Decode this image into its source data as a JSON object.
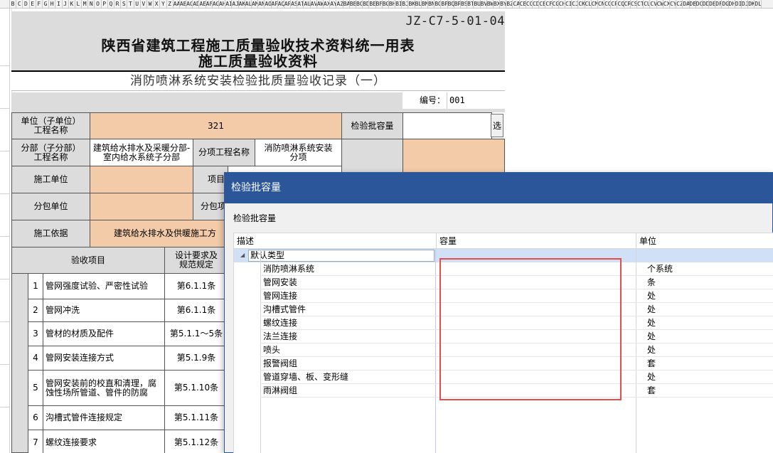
{
  "column_header_letters": [
    "B",
    "C",
    "D",
    "E",
    "F",
    "G",
    "H",
    "I",
    "J",
    "K",
    "L",
    "M",
    "N",
    "O",
    "P",
    "Q",
    "R",
    "S",
    "T",
    "U",
    "V",
    "W",
    "X",
    "Y",
    "Z",
    "AA",
    "AB",
    "AC",
    "AD",
    "AE",
    "AF",
    "AG",
    "AH",
    "AI",
    "AJ",
    "AK",
    "AL",
    "AM",
    "AN",
    "AO",
    "AP",
    "AQ",
    "AR",
    "AS",
    "AT",
    "AU",
    "AV",
    "AW",
    "AX",
    "AY",
    "AZ",
    "BA",
    "BB",
    "BC",
    "BD",
    "BE",
    "BF",
    "BG",
    "BH",
    "BI",
    "BJ",
    "BK",
    "BL",
    "BM",
    "BN",
    "BO",
    "BP",
    "BQ",
    "BR",
    "BS",
    "BT",
    "BU",
    "BV",
    "BW",
    "BX",
    "BY",
    "BZ",
    "CA",
    "CB",
    "CC",
    "CD",
    "CE",
    "CF",
    "CG",
    "CH",
    "CI",
    "CJ",
    "CK",
    "CL",
    "CM",
    "CN",
    "CO",
    "CP",
    "CQ",
    "CR",
    "CS",
    "CT",
    "CU",
    "CV",
    "CW",
    "CX",
    "CY",
    "CZ",
    "DA",
    "DB",
    "DC",
    "DD",
    "DE",
    "DF",
    "DG",
    "DH",
    "DI",
    "DJ",
    "DK",
    "DL"
  ],
  "form": {
    "code": "JZ-C7-5-01-04",
    "title_line1": "陕西省建筑工程施工质量验收技术资料统一用表",
    "title_line2": "施工质量验收资料",
    "subtitle": "消防喷淋系统安装检验批质量验收记录（一）",
    "number_label": "编号：",
    "number_value": "001",
    "unit_project_label": "单位（子单位）\n工程名称",
    "unit_project_value": "321",
    "batch_capacity_label": "检验批容量",
    "batch_capacity_value": "",
    "select_button": "选",
    "sub_division_label": "分部（子分部）\n工程名称",
    "sub_division_value": "建筑给水排水及采暖分部-室内给水系统子分部",
    "sub_item_label": "分项工程名称",
    "sub_item_value": "消防喷淋系统安装分项",
    "construction_unit_label": "施工单位",
    "project_partial": "项目",
    "subcontract_unit_label": "分包单位",
    "subcontract_partial": "分包项",
    "basis_label": "施工依据",
    "basis_value": "建筑给水排水及供暖施工方",
    "acceptance_items_label": "验收项目",
    "design_req_label": "设计要求及\n规范规定",
    "items": [
      {
        "no": "1",
        "name": "管网强度试验、严密性试验",
        "clause": "第6.1.1条"
      },
      {
        "no": "2",
        "name": "管网冲洗",
        "clause": "第6.1.1条"
      },
      {
        "no": "3",
        "name": "管材的材质及配件",
        "clause": "第5.1.1～5条"
      },
      {
        "no": "4",
        "name": "管网安装连接方式",
        "clause": "第5.1.9条"
      },
      {
        "no": "5",
        "name": "管网安装前的校直和清理，腐蚀性场所管道、管件的防腐",
        "clause": "第5.1.10条"
      },
      {
        "no": "6",
        "name": "沟槽式管件连接规定",
        "clause": "第5.1.11条"
      },
      {
        "no": "7",
        "name": "螺纹连接要求",
        "clause": "第5.1.12条"
      }
    ]
  },
  "dialog": {
    "title": "检验批容量",
    "section_label": "检验批容量",
    "columns": [
      "描述",
      "容量",
      "单位"
    ],
    "group_name": "默认类型",
    "rows": [
      {
        "desc": "消防喷淋系统",
        "capacity": "",
        "unit": "个系统"
      },
      {
        "desc": "管网安装",
        "capacity": "",
        "unit": "条"
      },
      {
        "desc": "管网连接",
        "capacity": "",
        "unit": "处"
      },
      {
        "desc": "沟槽式管件",
        "capacity": "",
        "unit": "处"
      },
      {
        "desc": "螺纹连接",
        "capacity": "",
        "unit": "处"
      },
      {
        "desc": "法兰连接",
        "capacity": "",
        "unit": "处"
      },
      {
        "desc": "喷头",
        "capacity": "",
        "unit": "处"
      },
      {
        "desc": "报警阀组",
        "capacity": "",
        "unit": "套"
      },
      {
        "desc": "管道穿墙、板、变形缝",
        "capacity": "",
        "unit": "处"
      },
      {
        "desc": "雨淋阀组",
        "capacity": "",
        "unit": "套"
      }
    ]
  },
  "colors": {
    "dialog_title_bg": "#2b579a",
    "peach_cell": "#f4cba8",
    "gray_band": "#dcdcdc",
    "group_row_bg": "#cfe0f7",
    "highlight_box": "#e84b4b"
  }
}
